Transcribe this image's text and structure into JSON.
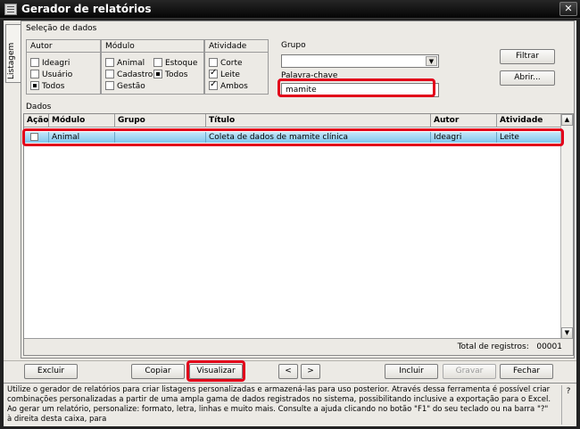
{
  "window": {
    "title": "Gerador de relatórios",
    "close_glyph": "✕",
    "icon": "list-window-icon"
  },
  "side_tab": {
    "label": "Listagem"
  },
  "selection": {
    "label": "Seleção de dados",
    "autor": {
      "header": "Autor",
      "options": [
        {
          "label": "Ideagri",
          "state": "empty"
        },
        {
          "label": "Usuário",
          "state": "empty"
        },
        {
          "label": "Todos",
          "state": "square"
        }
      ]
    },
    "modulo": {
      "header": "Módulo",
      "options": [
        {
          "label": "Animal",
          "state": "empty"
        },
        {
          "label": "Estoque",
          "state": "empty"
        },
        {
          "label": "Cadastro",
          "state": "empty"
        },
        {
          "label": "Todos",
          "state": "square"
        },
        {
          "label": "Gestão",
          "state": "empty"
        }
      ]
    },
    "atividade": {
      "header": "Atividade",
      "options": [
        {
          "label": "Corte",
          "state": "empty"
        },
        {
          "label": "Leite",
          "state": "checked"
        },
        {
          "label": "Ambos",
          "state": "checked"
        }
      ]
    },
    "grupo_label": "Grupo",
    "grupo_value": "",
    "keyword_label": "Palavra-chave",
    "keyword_value": "mamite"
  },
  "buttons": {
    "filtrar": "Filtrar",
    "abrir": "Abrir..."
  },
  "data": {
    "label": "Dados",
    "columns": [
      "Ação",
      "Módulo",
      "Grupo",
      "Título",
      "Autor",
      "Atividade"
    ],
    "rows": [
      {
        "acao": "",
        "modulo": "Animal",
        "grupo": "",
        "titulo": "Coleta de dados de mamite clínica",
        "autor": "Ideagri",
        "atividade": "Leite"
      }
    ],
    "total_label": "Total de registros:",
    "total_value": "00001"
  },
  "bottom_buttons": {
    "excluir": "Excluir",
    "copiar": "Copiar",
    "visualizar": "Visualizar",
    "prev": "<",
    "next": ">",
    "incluir": "Incluir",
    "gravar": "Gravar",
    "fechar": "Fechar"
  },
  "help": {
    "text": "Utilize o gerador de relatórios para criar listagens personalizadas e armazená-las para uso posterior. Através dessa ferramenta é possível criar combinações personalizadas a partir de uma ampla gama de dados registrados no sistema, possibilitando inclusive a exportação para o Excel. Ao gerar um relatório, personalize: formato, letra, linhas e muito mais. Consulte a ajuda clicando no botão \"F1\" do seu teclado ou na barra \"?\" à direita desta caixa, para",
    "help_glyph": "?"
  },
  "colors": {
    "highlight": "#e2001a",
    "row_selected": "#7fc6ee"
  }
}
